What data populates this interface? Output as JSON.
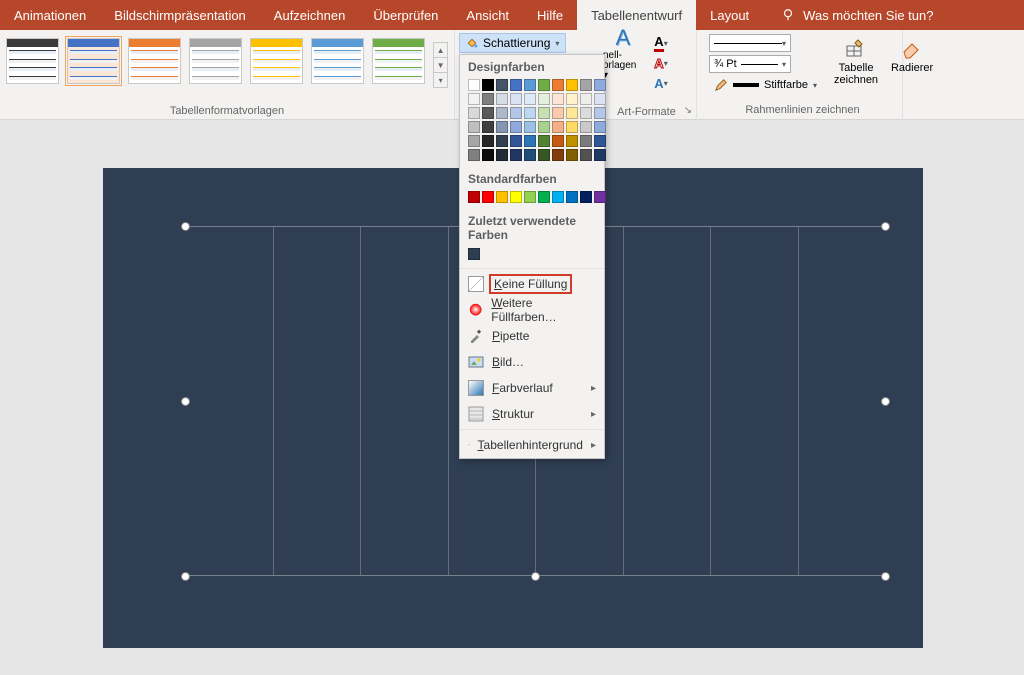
{
  "tabs": {
    "animationen": "Animationen",
    "bildschirm": "Bildschirmpräsentation",
    "aufzeichnen": "Aufzeichnen",
    "ueberpruefen": "Überprüfen",
    "ansicht": "Ansicht",
    "hilfe": "Hilfe",
    "tabellenentwurf": "Tabellenentwurf",
    "layout": "Layout",
    "tellme": "Was möchten Sie tun?"
  },
  "groups": {
    "tabellenformat": "Tabellenformatvorlagen",
    "wordart": "Art-Formate",
    "rahmen": "Rahmenlinien zeichnen"
  },
  "shading_label": "Schattierung",
  "wordart_sub": {
    "schnell": "nell-",
    "vorlagen": "orlagen"
  },
  "border": {
    "weight": "¾ Pt",
    "pen": "Stiftfarbe",
    "draw": "Tabelle zeichnen",
    "erase": "Radierer"
  },
  "dd": {
    "designfarben": "Designfarben",
    "standardfarben": "Standardfarben",
    "recent": "Zuletzt verwendete Farben",
    "nofill": "Keine Füllung",
    "more": "Weitere Füllfarben…",
    "pipette": "Pipette",
    "bild": "Bild…",
    "verlauf": "Farbverlauf",
    "struktur": "Struktur",
    "tblbg": "Tabellenhintergrund"
  },
  "colors": {
    "theme_row": [
      "#ffffff",
      "#000000",
      "#44546a",
      "#4472c4",
      "#5b9bd5",
      "#70ad47",
      "#ed7d31",
      "#ffc000",
      "#a5a5a5",
      "#8faadc"
    ],
    "theme_shades": [
      [
        "#f2f2f2",
        "#7f7f7f",
        "#d6dce5",
        "#d9e1f2",
        "#deebf7",
        "#e2efda",
        "#fce4d6",
        "#fff2cc",
        "#ededed",
        "#dae3f3"
      ],
      [
        "#d9d9d9",
        "#595959",
        "#adb9ca",
        "#b4c6e7",
        "#bdd7ee",
        "#c6e0b4",
        "#f8cbad",
        "#ffe699",
        "#dbdbdb",
        "#b4c7e7"
      ],
      [
        "#bfbfbf",
        "#404040",
        "#8497b0",
        "#8ea9db",
        "#9bc2e6",
        "#a9d08e",
        "#f4b084",
        "#ffd966",
        "#c9c9c9",
        "#8faadc"
      ],
      [
        "#a6a6a6",
        "#262626",
        "#333f4f",
        "#305496",
        "#2e75b6",
        "#548235",
        "#c65911",
        "#bf8f00",
        "#7b7b7b",
        "#2f5597"
      ],
      [
        "#808080",
        "#0d0d0d",
        "#222b35",
        "#203764",
        "#1f4e78",
        "#375623",
        "#833c0c",
        "#806000",
        "#525252",
        "#1f3864"
      ]
    ],
    "standard": [
      "#c00000",
      "#ff0000",
      "#ffc000",
      "#ffff00",
      "#92d050",
      "#00b050",
      "#00b0f0",
      "#0070c0",
      "#002060",
      "#7030a0"
    ]
  },
  "gallery_colors": [
    "#3a3a3a",
    "#4472c4",
    "#ed7d31",
    "#a5a5a5",
    "#ffc000",
    "#5b9bd5",
    "#70ad47"
  ]
}
